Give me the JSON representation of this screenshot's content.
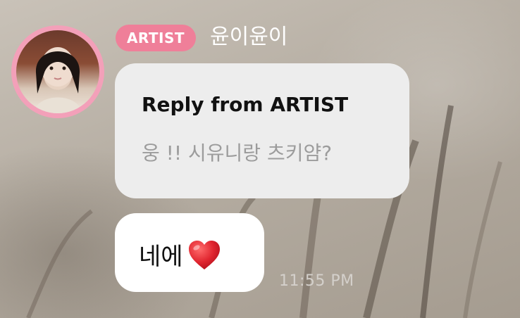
{
  "sender": {
    "badge": "ARTIST",
    "name": "윤이윤이",
    "avatar_ring_color": "#f3a0b9"
  },
  "reply": {
    "title": "Reply from ARTIST",
    "quoted_text": "웅 !! 시유니랑 츠키얌?"
  },
  "message": {
    "text": "네에",
    "emoji": "red-heart-icon"
  },
  "time": "11:55 PM",
  "colors": {
    "badge": "#ef7f99",
    "reply_bubble": "#ededed",
    "message_bubble": "#ffffff"
  }
}
